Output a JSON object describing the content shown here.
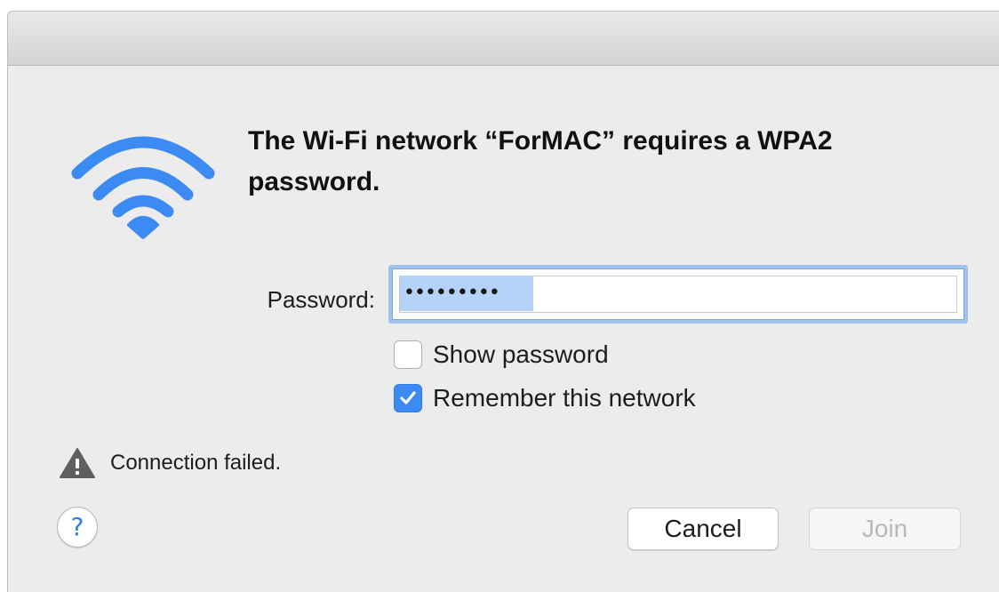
{
  "dialog": {
    "title": "The Wi-Fi network “ForMAC” requires a WPA2 password.",
    "icon": "wifi-icon",
    "accent_color": "#3b8bf3"
  },
  "password": {
    "label": "Password:",
    "value_masked": "•••••••••"
  },
  "options": {
    "show_password": {
      "label": "Show password",
      "checked": false
    },
    "remember_network": {
      "label": "Remember this network",
      "checked": true
    }
  },
  "status": {
    "icon": "warning-icon",
    "message": "Connection failed."
  },
  "buttons": {
    "help_label": "?",
    "cancel_label": "Cancel",
    "join_label": "Join",
    "join_enabled": false
  }
}
